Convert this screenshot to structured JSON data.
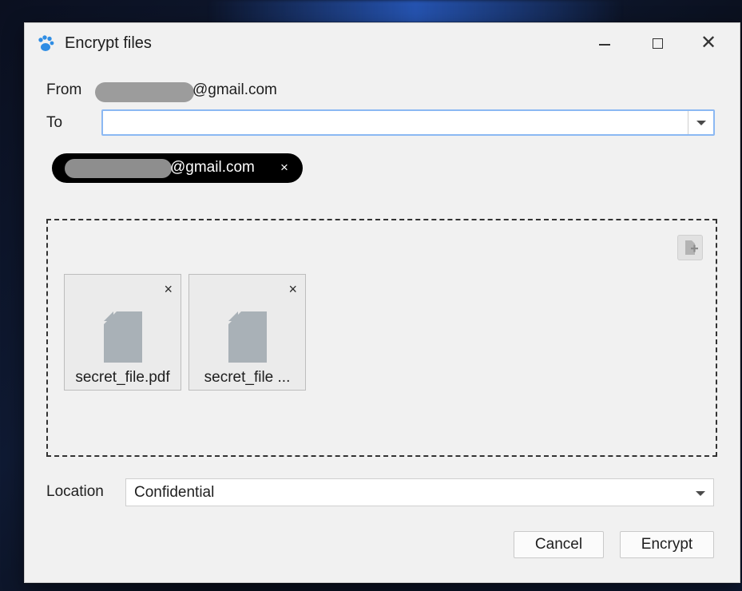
{
  "window": {
    "title": "Encrypt files",
    "app_icon": "paw-icon",
    "accent_color": "#2f8de4",
    "controls": {
      "minimize_icon": "minimize-icon",
      "maximize_icon": "maximize-icon",
      "close_icon": "close-icon"
    }
  },
  "from": {
    "label": "From",
    "domain": "@gmail.com"
  },
  "to": {
    "label": "To",
    "value": "",
    "placeholder": ""
  },
  "recipients": [
    {
      "domain": "@gmail.com",
      "remove_label": "×"
    }
  ],
  "files": {
    "add_icon": "add-file-icon",
    "items": [
      {
        "name": "secret_file.pdf",
        "remove_label": "×",
        "icon": "file-icon"
      },
      {
        "name": "secret_file ...",
        "remove_label": "×",
        "icon": "file-icon"
      }
    ]
  },
  "location": {
    "label": "Location",
    "value": "Confidential"
  },
  "buttons": {
    "cancel": "Cancel",
    "encrypt": "Encrypt"
  }
}
